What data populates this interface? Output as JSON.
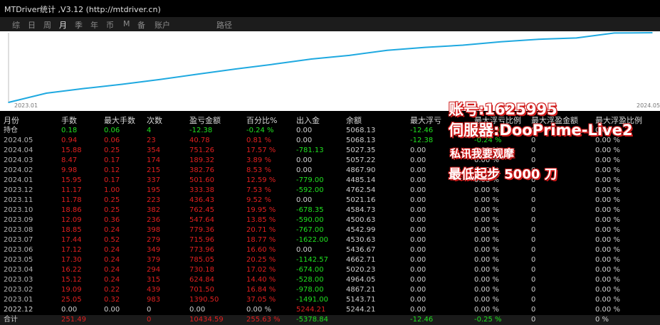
{
  "app": {
    "title": "MTDriver统计 ,V3.12 (http://mtdriver.cn)"
  },
  "tabs": [
    {
      "label": "综"
    },
    {
      "label": "日"
    },
    {
      "label": "周"
    },
    {
      "label": "月"
    },
    {
      "label": "季"
    },
    {
      "label": "年"
    },
    {
      "label": "币"
    },
    {
      "label": "M"
    },
    {
      "label": "备"
    },
    {
      "label": "账户"
    },
    {
      "label": "路径"
    }
  ],
  "active_tab": "月",
  "chart_data": {
    "type": "line",
    "x_start_label": "2023.01",
    "x_end_label": "2024.05",
    "x": [
      "2022.12",
      "2023.01",
      "2023.02",
      "2023.03",
      "2023.04",
      "2023.05",
      "2023.06",
      "2023.07",
      "2023.08",
      "2023.09",
      "2023.10",
      "2023.11",
      "2023.12",
      "2024.01",
      "2024.02",
      "2024.03",
      "2024.04",
      "2024.05"
    ],
    "y": [
      0,
      1390.5,
      2092.0,
      2716.84,
      3446.86,
      4231.91,
      5005.87,
      5721.83,
      6501.19,
      7048.83,
      7811.28,
      8247.71,
      8581.09,
      9082.69,
      9465.45,
      9654.77,
      10406.03,
      10446.81
    ],
    "line_color": "#1fa9e0",
    "grid": false
  },
  "table": {
    "headers": [
      "月份",
      "手数",
      "最大手数",
      "次数",
      "盈亏金额",
      "百分比%",
      "出入金",
      "余额",
      "最大浮亏",
      "最大浮亏比例",
      "最大浮盈金额",
      "最大浮盈比例"
    ],
    "rows": [
      {
        "c": [
          "持仓",
          "0.18",
          "0.06",
          "4",
          "-12.38",
          "-0.24 %",
          "0.00",
          "5068.13",
          "-12.46",
          "-0.24 %",
          "0",
          "0.00 %"
        ],
        "k": [
          "white",
          "green",
          "green",
          "green",
          "green",
          "green",
          "white",
          "white",
          "green",
          "green",
          "white",
          "white"
        ]
      },
      {
        "c": [
          "2024.05",
          "0.94",
          "0.06",
          "23",
          "40.78",
          "0.81 %",
          "0.00",
          "5068.13",
          "-12.38",
          "-0.24 %",
          "0",
          "0.00 %"
        ],
        "k": [
          "grey",
          "red",
          "red",
          "red",
          "red",
          "red",
          "white",
          "white",
          "green",
          "green",
          "white",
          "white"
        ]
      },
      {
        "c": [
          "2024.04",
          "15.88",
          "0.25",
          "354",
          "751.26",
          "17.57 %",
          "-781.13",
          "5027.35",
          "0.00",
          "0.00 %",
          "0",
          "0.00 %"
        ],
        "k": [
          "grey",
          "red",
          "red",
          "red",
          "red",
          "red",
          "green",
          "white",
          "white",
          "white",
          "white",
          "white"
        ]
      },
      {
        "c": [
          "2024.03",
          "8.47",
          "0.17",
          "174",
          "189.32",
          "3.89 %",
          "0.00",
          "5057.22",
          "0.00",
          "0.00 %",
          "0",
          "0.00 %"
        ],
        "k": [
          "grey",
          "red",
          "red",
          "red",
          "red",
          "red",
          "white",
          "white",
          "white",
          "white",
          "white",
          "white"
        ]
      },
      {
        "c": [
          "2024.02",
          "9.98",
          "0.12",
          "215",
          "382.76",
          "8.53 %",
          "0.00",
          "4867.90",
          "0.00",
          "0.00 %",
          "0",
          "0.00 %"
        ],
        "k": [
          "grey",
          "red",
          "red",
          "red",
          "red",
          "red",
          "white",
          "white",
          "white",
          "white",
          "white",
          "white"
        ]
      },
      {
        "c": [
          "2024.01",
          "15.95",
          "0.17",
          "337",
          "501.60",
          "12.59 %",
          "-779.00",
          "4485.14",
          "0.00",
          "0.00 %",
          "0",
          "0.00 %"
        ],
        "k": [
          "grey",
          "red",
          "red",
          "red",
          "red",
          "red",
          "green",
          "white",
          "white",
          "white",
          "white",
          "white"
        ]
      },
      {
        "c": [
          "2023.12",
          "11.17",
          "1.00",
          "195",
          "333.38",
          "7.53 %",
          "-592.00",
          "4762.54",
          "0.00",
          "0.00 %",
          "0",
          "0.00 %"
        ],
        "k": [
          "grey",
          "red",
          "red",
          "red",
          "red",
          "red",
          "green",
          "white",
          "white",
          "white",
          "white",
          "white"
        ]
      },
      {
        "c": [
          "2023.11",
          "11.78",
          "0.25",
          "223",
          "436.43",
          "9.52 %",
          "0.00",
          "5021.16",
          "0.00",
          "0.00 %",
          "0",
          "0.00 %"
        ],
        "k": [
          "grey",
          "red",
          "red",
          "red",
          "red",
          "red",
          "white",
          "white",
          "white",
          "white",
          "white",
          "white"
        ]
      },
      {
        "c": [
          "2023.10",
          "18.86",
          "0.25",
          "382",
          "762.45",
          "19.95 %",
          "-678.35",
          "4584.73",
          "0.00",
          "0.00 %",
          "0",
          "0.00 %"
        ],
        "k": [
          "grey",
          "red",
          "red",
          "red",
          "red",
          "red",
          "green",
          "white",
          "white",
          "white",
          "white",
          "white"
        ]
      },
      {
        "c": [
          "2023.09",
          "12.09",
          "0.36",
          "236",
          "547.64",
          "13.85 %",
          "-590.00",
          "4500.63",
          "0.00",
          "0.00 %",
          "0",
          "0.00 %"
        ],
        "k": [
          "grey",
          "red",
          "red",
          "red",
          "red",
          "red",
          "green",
          "white",
          "white",
          "white",
          "white",
          "white"
        ]
      },
      {
        "c": [
          "2023.08",
          "18.85",
          "0.24",
          "398",
          "779.36",
          "20.71 %",
          "-767.00",
          "4542.99",
          "0.00",
          "0.00 %",
          "0",
          "0.00 %"
        ],
        "k": [
          "grey",
          "red",
          "red",
          "red",
          "red",
          "red",
          "green",
          "white",
          "white",
          "white",
          "white",
          "white"
        ]
      },
      {
        "c": [
          "2023.07",
          "17.44",
          "0.52",
          "279",
          "715.96",
          "18.77 %",
          "-1622.00",
          "4530.63",
          "0.00",
          "0.00 %",
          "0",
          "0.00 %"
        ],
        "k": [
          "grey",
          "red",
          "red",
          "red",
          "red",
          "red",
          "green",
          "white",
          "white",
          "white",
          "white",
          "white"
        ]
      },
      {
        "c": [
          "2023.06",
          "17.12",
          "0.24",
          "349",
          "773.96",
          "16.60 %",
          "0.00",
          "5436.67",
          "0.00",
          "0.00 %",
          "0",
          "0.00 %"
        ],
        "k": [
          "grey",
          "red",
          "red",
          "red",
          "red",
          "red",
          "white",
          "white",
          "white",
          "white",
          "white",
          "white"
        ]
      },
      {
        "c": [
          "2023.05",
          "17.30",
          "0.24",
          "379",
          "785.05",
          "20.25 %",
          "-1142.57",
          "4662.71",
          "0.00",
          "0.00 %",
          "0",
          "0.00 %"
        ],
        "k": [
          "grey",
          "red",
          "red",
          "red",
          "red",
          "red",
          "green",
          "white",
          "white",
          "white",
          "white",
          "white"
        ]
      },
      {
        "c": [
          "2023.04",
          "16.22",
          "0.24",
          "294",
          "730.18",
          "17.02 %",
          "-674.00",
          "5020.23",
          "0.00",
          "0.00 %",
          "0",
          "0.00 %"
        ],
        "k": [
          "grey",
          "red",
          "red",
          "red",
          "red",
          "red",
          "green",
          "white",
          "white",
          "white",
          "white",
          "white"
        ]
      },
      {
        "c": [
          "2023.03",
          "15.12",
          "0.24",
          "315",
          "624.84",
          "14.40 %",
          "-528.00",
          "4964.05",
          "0.00",
          "0.00 %",
          "0",
          "0.00 %"
        ],
        "k": [
          "grey",
          "red",
          "red",
          "red",
          "red",
          "red",
          "green",
          "white",
          "white",
          "white",
          "white",
          "white"
        ]
      },
      {
        "c": [
          "2023.02",
          "19.09",
          "0.22",
          "439",
          "701.50",
          "16.84 %",
          "-978.00",
          "4867.21",
          "0.00",
          "0.00 %",
          "0",
          "0.00 %"
        ],
        "k": [
          "grey",
          "red",
          "red",
          "red",
          "red",
          "red",
          "green",
          "white",
          "white",
          "white",
          "white",
          "white"
        ]
      },
      {
        "c": [
          "2023.01",
          "25.05",
          "0.32",
          "983",
          "1390.50",
          "37.05 %",
          "-1491.00",
          "5143.71",
          "0.00",
          "0.00 %",
          "0",
          "0.00 %"
        ],
        "k": [
          "grey",
          "red",
          "red",
          "red",
          "red",
          "red",
          "green",
          "white",
          "white",
          "white",
          "white",
          "white"
        ]
      },
      {
        "c": [
          "2022.12",
          "0.00",
          "0.00",
          "0",
          "0.00",
          "0.00 %",
          "5244.21",
          "5244.21",
          "0.00",
          "0.00 %",
          "0",
          "0.00 %"
        ],
        "k": [
          "white",
          "white",
          "white",
          "white",
          "white",
          "white",
          "red",
          "white",
          "white",
          "white",
          "white",
          "white"
        ]
      }
    ],
    "total": {
      "c": [
        "合计",
        "251.49",
        "",
        "0",
        "10434.59",
        "255.63 %",
        "-5378.84",
        "",
        "-12.46",
        "-0.25 %",
        "0",
        "0 %"
      ],
      "k": [
        "white",
        "red",
        "red",
        "red",
        "red",
        "red",
        "green",
        "white",
        "green",
        "green",
        "white",
        "white"
      ]
    }
  },
  "overlay": {
    "account": "账号:1625995",
    "server": "伺服器:DooPrime-Live2",
    "dm": "私讯我要观摩",
    "minimum": "最低起步 5000 刀"
  }
}
